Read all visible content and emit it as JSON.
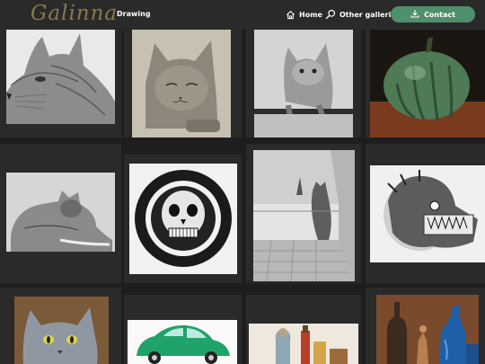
{
  "header": {
    "logo": "Galinna",
    "crumb": "Drawing",
    "nav": {
      "home_label": "Home",
      "other_label": "Other galleries",
      "contact_label": "Contact"
    },
    "icons": [
      "home-icon",
      "search-icon",
      "download-icon"
    ],
    "accent_color": "#4f8f6b"
  },
  "gallery": {
    "artworks": [
      "cat-profile-drawing",
      "sleepy-cat-drawing",
      "cat-on-ledge-drawing",
      "green-pumpkin-painting",
      "lying-cat-drawing",
      "skull-circle-drawing",
      "cat-at-window-drawing",
      "aztec-serpent-drawing",
      "grey-cat-painting",
      "green-car-drawing",
      "still-life-figures-painting",
      "blue-bottles-painting"
    ]
  }
}
